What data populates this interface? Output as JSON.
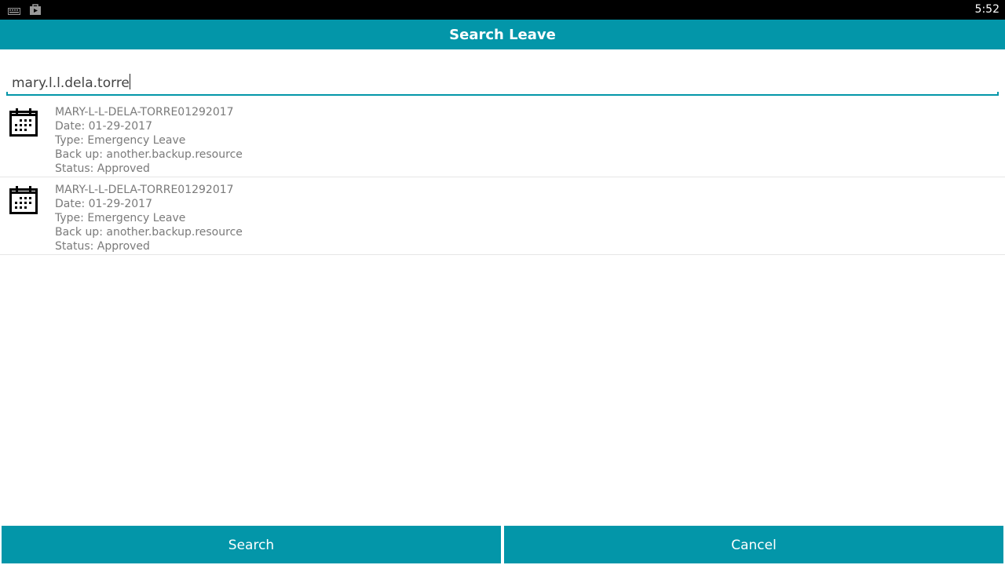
{
  "status_bar": {
    "time": "5:52",
    "icons": [
      "keyboard-icon",
      "shopping-bag-icon"
    ]
  },
  "header": {
    "title": "Search Leave",
    "color": "#0396a9"
  },
  "search": {
    "value": "mary.l.l.dela.torre"
  },
  "results": [
    {
      "icon": "calendar-icon",
      "id": "MARY-L-L-DELA-TORRE01292017",
      "date": "Date: 01-29-2017",
      "type": "Type: Emergency Leave",
      "backup": "Back up: another.backup.resource",
      "status": "Status: Approved"
    },
    {
      "icon": "calendar-icon",
      "id": "MARY-L-L-DELA-TORRE01292017",
      "date": "Date: 01-29-2017",
      "type": "Type: Emergency Leave",
      "backup": "Back up: another.backup.resource",
      "status": "Status: Approved"
    }
  ],
  "buttons": {
    "search_label": "Search",
    "cancel_label": "Cancel"
  }
}
